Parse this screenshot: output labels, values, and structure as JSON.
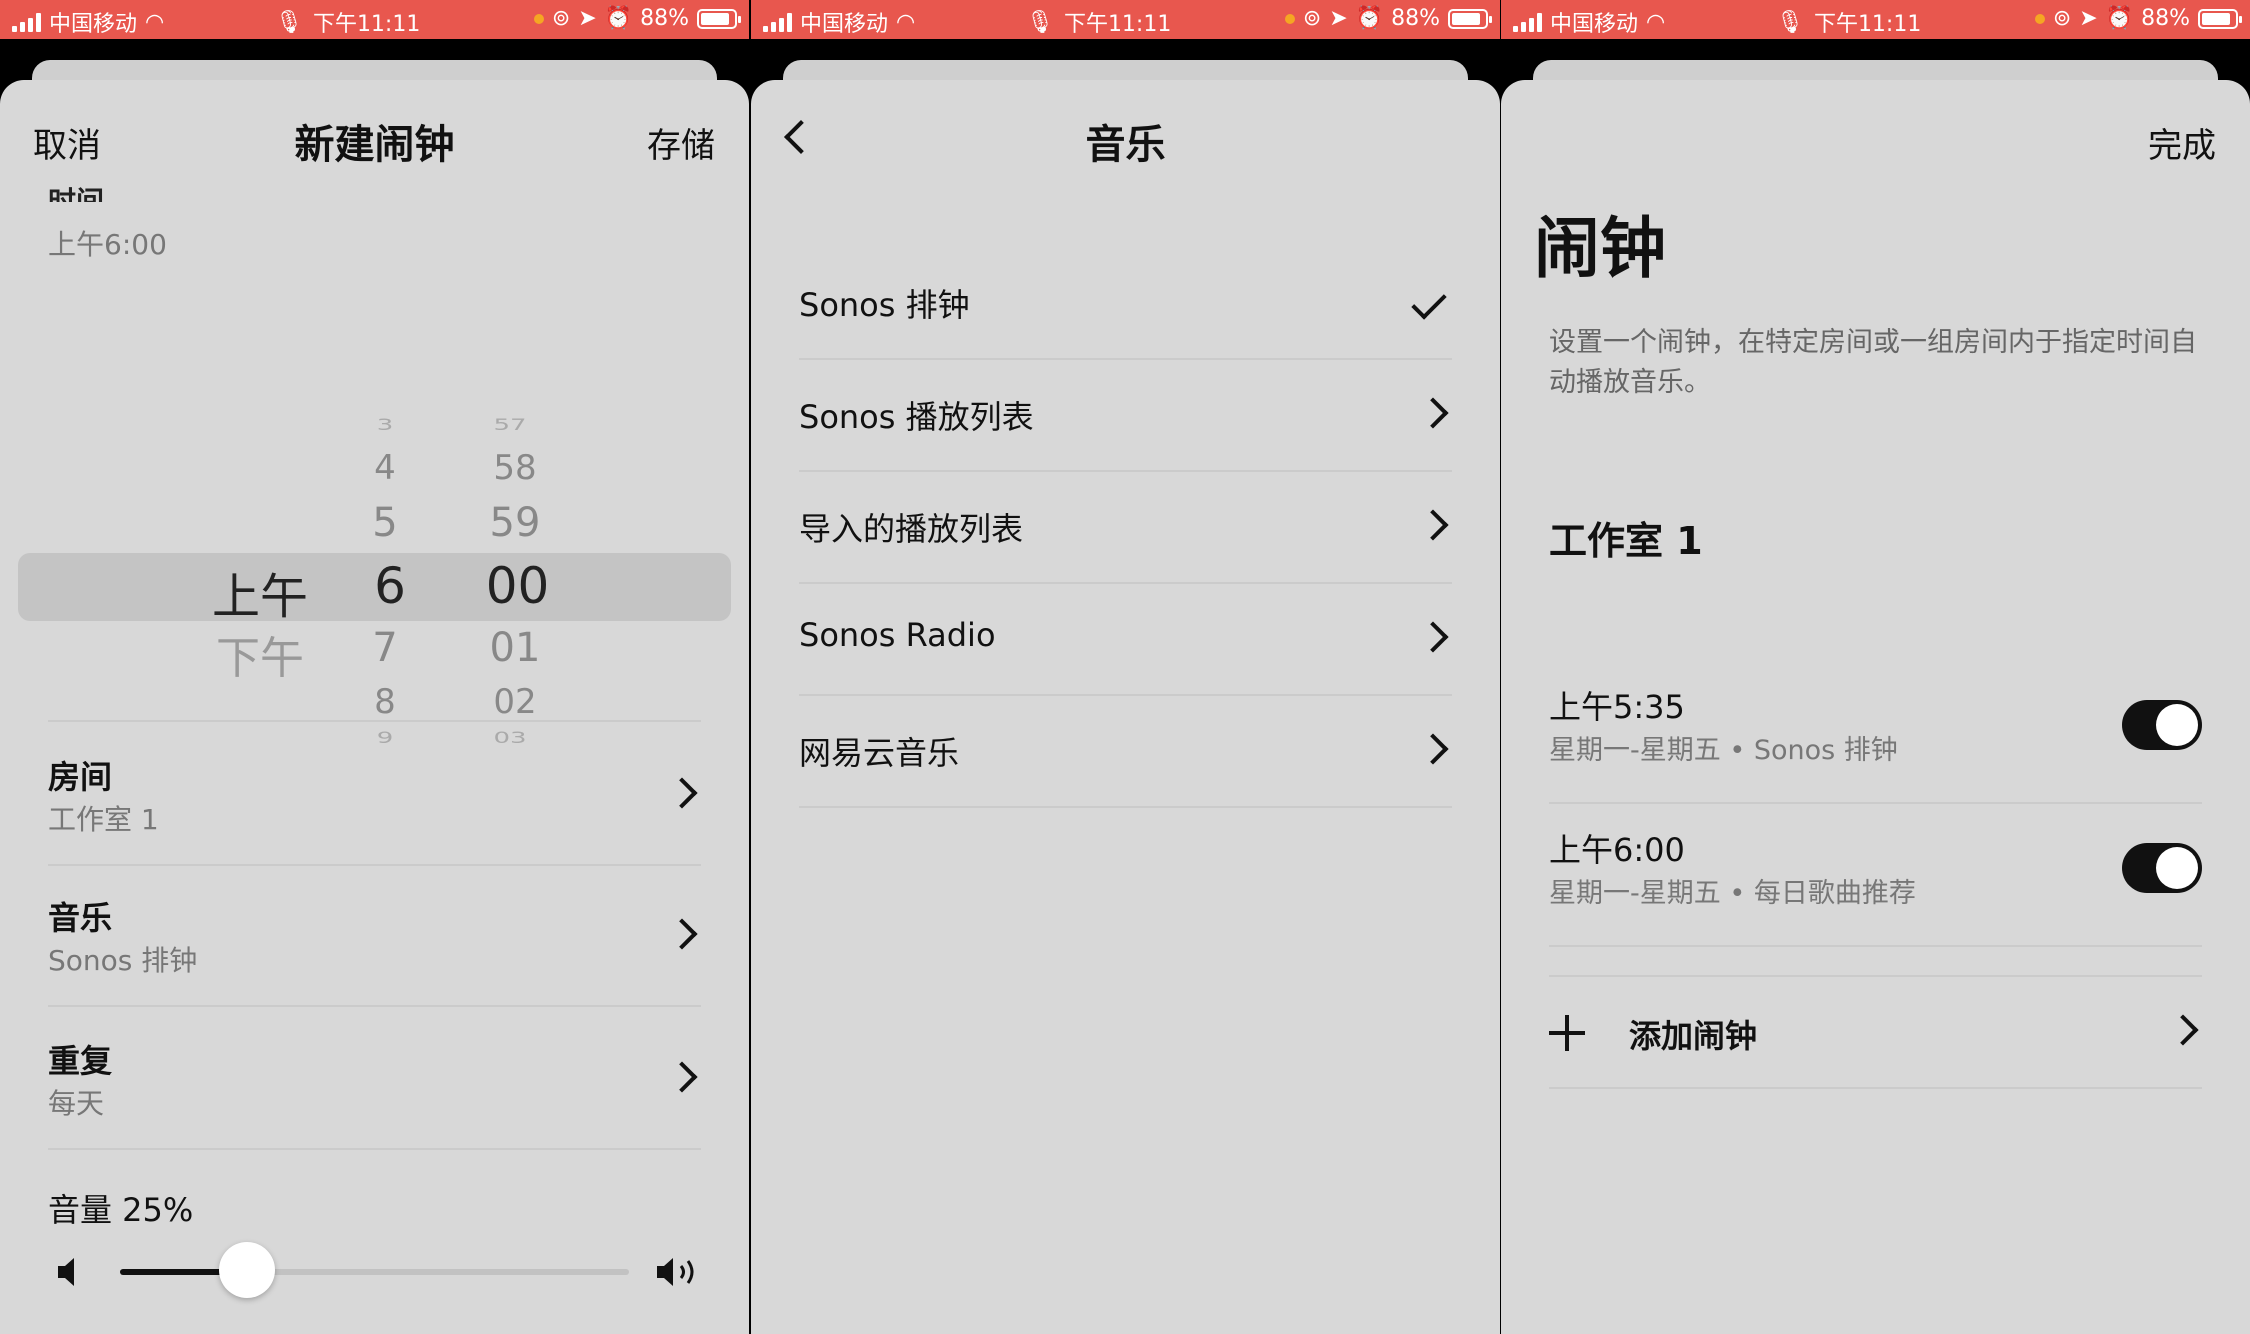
{
  "status": {
    "carrier": "中国移动",
    "time": "下午11:11",
    "battery": "88%",
    "battery_level": 0.88
  },
  "panel1": {
    "cancel": "取消",
    "title": "新建闹钟",
    "save": "存储",
    "time_label": "时间",
    "time_value": "上午6:00",
    "picker": {
      "ampm": [
        "上午",
        "下午"
      ],
      "hours": [
        "3",
        "4",
        "5",
        "6",
        "7",
        "8",
        "9"
      ],
      "minutes": [
        "57",
        "58",
        "59",
        "00",
        "01",
        "02",
        "03"
      ],
      "selected_ampm": "上午",
      "selected_hour": "6",
      "selected_minute": "00"
    },
    "rows": [
      {
        "title": "房间",
        "value": "工作室 1"
      },
      {
        "title": "音乐",
        "value": "Sonos 排钟"
      },
      {
        "title": "重复",
        "value": "每天"
      }
    ],
    "volume_label": "音量 25%",
    "volume_level": 0.25
  },
  "panel2": {
    "title": "音乐",
    "items": [
      {
        "label": "Sonos 排钟",
        "selected": true
      },
      {
        "label": "Sonos 播放列表",
        "selected": false
      },
      {
        "label": "导入的播放列表",
        "selected": false
      },
      {
        "label": "Sonos Radio",
        "selected": false
      },
      {
        "label": "网易云音乐",
        "selected": false
      }
    ]
  },
  "panel3": {
    "done": "完成",
    "title": "闹钟",
    "description": "设置一个闹钟，在特定房间或一组房间内于指定时间自动播放音乐。",
    "room": "工作室 1",
    "alarms": [
      {
        "time": "上午5:35",
        "detail": "星期一-星期五 • Sonos 排钟",
        "enabled": true
      },
      {
        "time": "上午6:00",
        "detail": "星期一-星期五 • 每日歌曲推荐",
        "enabled": true
      }
    ],
    "add_label": "添加闹钟"
  }
}
